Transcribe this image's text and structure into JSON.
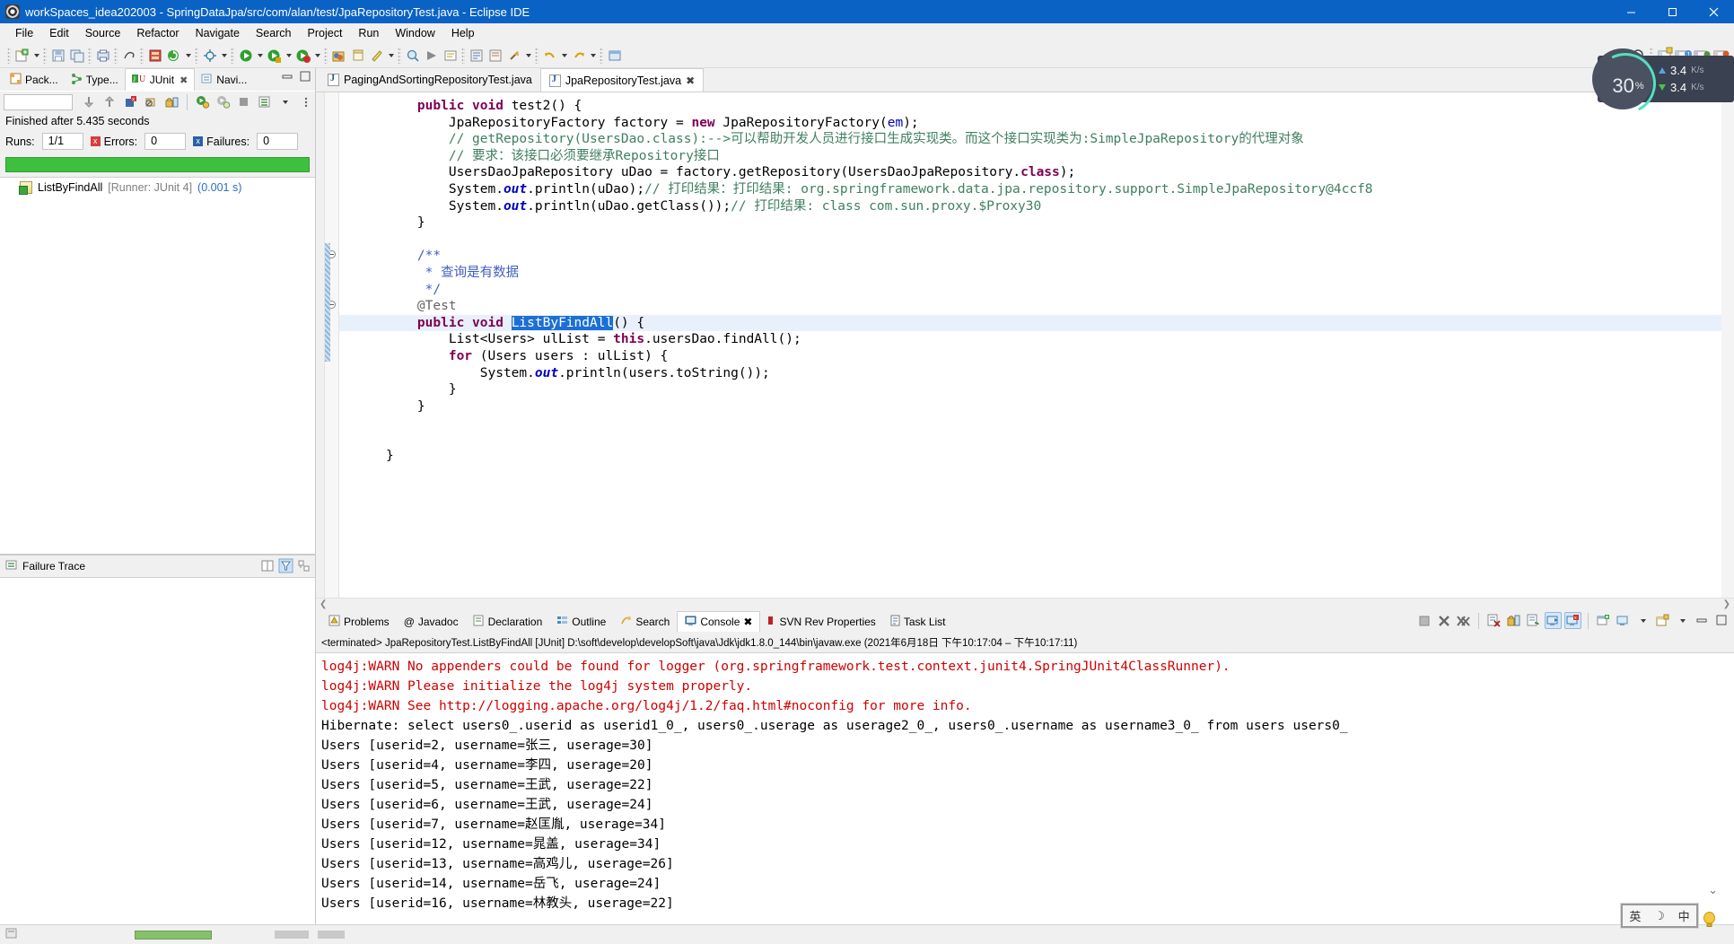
{
  "window": {
    "title": "workSpaces_idea202003 - SpringDataJpa/src/com/alan/test/JpaRepositoryTest.java - Eclipse IDE",
    "app_icon": "eclipse-icon",
    "minimize": "minimize-button",
    "maximize": "maximize-button",
    "close": "close-button"
  },
  "menubar": {
    "items": [
      "File",
      "Edit",
      "Source",
      "Refactor",
      "Navigate",
      "Search",
      "Project",
      "Run",
      "Window",
      "Help"
    ]
  },
  "toolbar": {
    "search_icon": "search-icon",
    "perspective_icons": [
      "java-perspective-icon",
      "debug-perspective-icon",
      "open-perspective-icon"
    ]
  },
  "junit_view": {
    "tabs": [
      {
        "label": "Pack...",
        "icon": "package-explorer-icon",
        "active": false
      },
      {
        "label": "Type...",
        "icon": "type-hierarchy-icon",
        "active": false
      },
      {
        "label": "JUnit",
        "icon": "junit-icon",
        "active": true,
        "close": "✖"
      },
      {
        "label": "Navi...",
        "icon": "navigator-icon",
        "active": false
      }
    ],
    "status": "Finished after 5.435 seconds",
    "runs_label": "Runs:",
    "runs_value": "1/1",
    "errors_label": "Errors:",
    "errors_value": "0",
    "failures_label": "Failures:",
    "failures_value": "0",
    "progress_color": "#3fbf3f",
    "tree": [
      {
        "name": "ListByFindAll",
        "runner": "[Runner: JUnit 4]",
        "time": "(0.001 s)"
      }
    ],
    "failure_trace_title": "Failure Trace",
    "failure_trace_icon": "failure-trace-icon"
  },
  "editor": {
    "tabs": [
      {
        "label": "PagingAndSortingRepositoryTest.java",
        "active": false
      },
      {
        "label": "JpaRepositoryTest.java",
        "active": true,
        "close": "✖"
      }
    ],
    "lines": [
      {
        "indent": 0,
        "spans": [
          {
            "t": "    ",
            "c": "plain"
          },
          {
            "t": "public",
            "c": "kw"
          },
          {
            "t": " ",
            "c": "plain"
          },
          {
            "t": "void",
            "c": "kw"
          },
          {
            "t": " test2() {",
            "c": "plain"
          }
        ]
      },
      {
        "indent": 0,
        "spans": [
          {
            "t": "        JpaRepositoryFactory factory = ",
            "c": "plain"
          },
          {
            "t": "new",
            "c": "kw"
          },
          {
            "t": " JpaRepositoryFactory(",
            "c": "plain"
          },
          {
            "t": "em",
            "c": "fld"
          },
          {
            "t": ");",
            "c": "plain"
          }
        ]
      },
      {
        "indent": 0,
        "spans": [
          {
            "t": "        // getRepository(UsersDao.class):-->可以帮助开发人员进行接口生成实现类。而这个接口实现类为:SimpleJpaRepository的代理对象",
            "c": "cmt"
          }
        ]
      },
      {
        "indent": 0,
        "spans": [
          {
            "t": "        // 要求：该接口必须要继承Repository接口",
            "c": "cmt"
          }
        ]
      },
      {
        "indent": 0,
        "spans": [
          {
            "t": "        UsersDaoJpaRepository uDao = factory.getRepository(UsersDaoJpaRepository.",
            "c": "plain"
          },
          {
            "t": "class",
            "c": "kw"
          },
          {
            "t": ");",
            "c": "plain"
          }
        ]
      },
      {
        "indent": 0,
        "spans": [
          {
            "t": "        System.",
            "c": "plain"
          },
          {
            "t": "out",
            "c": "stat"
          },
          {
            "t": ".println(uDao);",
            "c": "plain"
          },
          {
            "t": "// 打印结果：打印结果: org.springframework.data.jpa.repository.support.SimpleJpaRepository@4ccf8",
            "c": "cmt"
          }
        ]
      },
      {
        "indent": 0,
        "spans": [
          {
            "t": "        System.",
            "c": "plain"
          },
          {
            "t": "out",
            "c": "stat"
          },
          {
            "t": ".println(uDao.getClass());",
            "c": "plain"
          },
          {
            "t": "// 打印结果: class com.sun.proxy.$Proxy30",
            "c": "cmt"
          }
        ]
      },
      {
        "indent": 0,
        "spans": [
          {
            "t": "    }",
            "c": "plain"
          }
        ]
      },
      {
        "indent": 0,
        "spans": [
          {
            "t": "",
            "c": "plain"
          }
        ]
      },
      {
        "indent": 0,
        "spans": [
          {
            "t": "    /**",
            "c": "jdoc"
          }
        ]
      },
      {
        "indent": 0,
        "spans": [
          {
            "t": "     * 查询是有数据",
            "c": "jdoc"
          }
        ]
      },
      {
        "indent": 0,
        "spans": [
          {
            "t": "     */",
            "c": "jdoc"
          }
        ]
      },
      {
        "indent": 0,
        "spans": [
          {
            "t": "    @Test",
            "c": "ann"
          }
        ]
      },
      {
        "indent": 0,
        "highlight": true,
        "spans": [
          {
            "t": "    ",
            "c": "plain"
          },
          {
            "t": "public",
            "c": "kw"
          },
          {
            "t": " ",
            "c": "plain"
          },
          {
            "t": "void",
            "c": "kw"
          },
          {
            "t": " ",
            "c": "plain"
          },
          {
            "t": "ListByFindAll",
            "c": "sel"
          },
          {
            "t": "() {",
            "c": "plain"
          }
        ]
      },
      {
        "indent": 0,
        "spans": [
          {
            "t": "        List<Users> ulList = ",
            "c": "plain"
          },
          {
            "t": "this",
            "c": "kw"
          },
          {
            "t": ".usersDao.findAll();",
            "c": "plain"
          }
        ]
      },
      {
        "indent": 0,
        "spans": [
          {
            "t": "        ",
            "c": "plain"
          },
          {
            "t": "for",
            "c": "kw"
          },
          {
            "t": " (Users users : ulList) {",
            "c": "plain"
          }
        ]
      },
      {
        "indent": 0,
        "spans": [
          {
            "t": "            System.",
            "c": "plain"
          },
          {
            "t": "out",
            "c": "stat"
          },
          {
            "t": ".println(users.toString());",
            "c": "plain"
          }
        ]
      },
      {
        "indent": 0,
        "spans": [
          {
            "t": "        }",
            "c": "plain"
          }
        ]
      },
      {
        "indent": 0,
        "spans": [
          {
            "t": "    }",
            "c": "plain"
          }
        ]
      },
      {
        "indent": 0,
        "spans": [
          {
            "t": "",
            "c": "plain"
          }
        ]
      },
      {
        "indent": 0,
        "spans": [
          {
            "t": "",
            "c": "plain"
          }
        ]
      },
      {
        "indent": 0,
        "spans": [
          {
            "t": "}",
            "c": "plain"
          }
        ]
      }
    ]
  },
  "console": {
    "tabs": [
      {
        "label": "Problems",
        "icon": "problems-icon",
        "active": false
      },
      {
        "label": "Javadoc",
        "icon": "javadoc-icon",
        "active": false
      },
      {
        "label": "Declaration",
        "icon": "declaration-icon",
        "active": false
      },
      {
        "label": "Outline",
        "icon": "outline-icon",
        "active": false
      },
      {
        "label": "Search",
        "icon": "search-icon",
        "active": false
      },
      {
        "label": "Console",
        "icon": "console-icon",
        "active": true,
        "close": "✖"
      },
      {
        "label": "SVN Rev Properties",
        "icon": "svn-icon",
        "active": false
      },
      {
        "label": "Task List",
        "icon": "tasklist-icon",
        "active": false
      }
    ],
    "launch_info": "<terminated> JpaRepositoryTest.ListByFindAll [JUnit] D:\\soft\\develop\\developSoft\\java\\Jdk\\jdk1.8.0_144\\bin\\javaw.exe  (2021年6月18日 下午10:17:04 – 下午10:17:11)",
    "toolbar_icons": [
      "terminate-icon",
      "remove-launch-icon",
      "remove-all-launches-icon",
      "clear-console-icon",
      "scroll-lock-icon",
      "word-wrap-icon",
      "show-console-on-output-icon",
      "show-console-on-error-icon",
      "pin-console-icon",
      "display-selected-console-icon",
      "chevron-down-icon",
      "open-console-icon",
      "chevron-down-icon-2",
      "minimize-icon",
      "maximize-icon"
    ],
    "output": [
      {
        "text": "log4j:WARN No appenders could be found for logger (org.springframework.test.context.junit4.SpringJUnit4ClassRunner).",
        "level": "error"
      },
      {
        "text": "log4j:WARN Please initialize the log4j system properly.",
        "level": "error"
      },
      {
        "text": "log4j:WARN See http://logging.apache.org/log4j/1.2/faq.html#noconfig for more info.",
        "level": "error"
      },
      {
        "text": "Hibernate: select users0_.userid as userid1_0_, users0_.userage as userage2_0_, users0_.username as username3_0_ from users users0_",
        "level": "out"
      },
      {
        "text": "Users [userid=2, username=张三, userage=30]",
        "level": "out"
      },
      {
        "text": "Users [userid=4, username=李四, userage=20]",
        "level": "out"
      },
      {
        "text": "Users [userid=5, username=王武, userage=22]",
        "level": "out"
      },
      {
        "text": "Users [userid=6, username=王武, userage=24]",
        "level": "out"
      },
      {
        "text": "Users [userid=7, username=赵匡胤, userage=34]",
        "level": "out"
      },
      {
        "text": "Users [userid=12, username=晁盖, userage=34]",
        "level": "out"
      },
      {
        "text": "Users [userid=13, username=高鸡儿, userage=26]",
        "level": "out"
      },
      {
        "text": "Users [userid=14, username=岳飞, userage=24]",
        "level": "out"
      },
      {
        "text": "Users [userid=16, username=林教头, userage=22]",
        "level": "out"
      }
    ]
  },
  "overlays": {
    "network_monitor": {
      "percent": "30",
      "percent_suffix": "%",
      "upload_value": "3.4",
      "upload_unit": "K/s",
      "download_value": "3.4",
      "download_unit": "K/s",
      "ring_color": "#52e0c0"
    },
    "ime": {
      "mode": "英",
      "moon": "☽",
      "punct": "中",
      "bulb_icon": "lightbulb-icon"
    }
  },
  "statusbar": {
    "left": ""
  }
}
